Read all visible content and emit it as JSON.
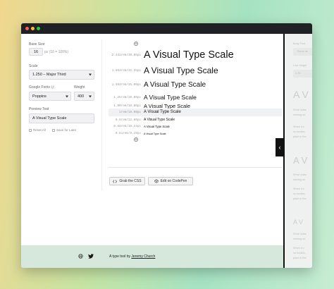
{
  "colors": {
    "accent": "#6ec1a0",
    "titlebar": "#202124",
    "footer": "#d6e7db"
  },
  "window": {
    "controls": [
      {
        "name": "close",
        "color": "#ff5f57"
      },
      {
        "name": "minimize",
        "color": "#febc2e"
      },
      {
        "name": "maximize",
        "color": "#28c840"
      }
    ]
  },
  "sidebar": {
    "base_size": {
      "label": "Base Size",
      "value": "16",
      "unit": "px (16 = 100%)"
    },
    "scale": {
      "label": "Scale",
      "value": "1.250 – Major Third"
    },
    "google_fonts": {
      "label": "Google Fonts",
      "value": "Poppins"
    },
    "weight": {
      "label": "Weight",
      "value": "400"
    },
    "preview_text": {
      "label": "Preview Text",
      "value": "A Visual Type Scale"
    },
    "reset": "Reset All",
    "save": "Save for Later"
  },
  "scale_rows": [
    {
      "meta": "2.441rem/39.06px",
      "text": "A Visual Type Scale"
    },
    {
      "meta": "1.953rem/31.25px",
      "text": "A Visual Type Scale"
    },
    {
      "meta": "1.563rem/25.00px",
      "text": "A Visual Type Scale"
    },
    {
      "meta": "1.25rem/20.00px",
      "text": "A Visual Type Scale"
    },
    {
      "meta": "1.00rem/16.00px",
      "text": "A Visual Type Scale"
    },
    {
      "meta": "1rem/16.00px",
      "text": "A Visual Type Scale"
    },
    {
      "meta": "0.8rem/12.80px",
      "text": "A Visual Type Scale"
    },
    {
      "meta": "0.64rem/10.24px",
      "text": "A Visual Type Scale"
    },
    {
      "meta": "0.51rem/8.19px",
      "text": "A Visual Type Scale"
    }
  ],
  "buttons": {
    "grab_css": "Grab the CSS",
    "codepen": "Edit on CodePen"
  },
  "footer": {
    "credit_prefix": "A type tool by",
    "author": "Jeremy Church"
  },
  "preview": {
    "label1": "Body Font",
    "value1": "Same as",
    "label2": "Line Height",
    "value2": "1.75",
    "heading": "A V",
    "paras": [
      "What looks",
      "moving ac",
      "When it c",
      "no bodies,",
      "plant in the",
      "When it c",
      "no bodies,",
      "plant in the"
    ]
  }
}
